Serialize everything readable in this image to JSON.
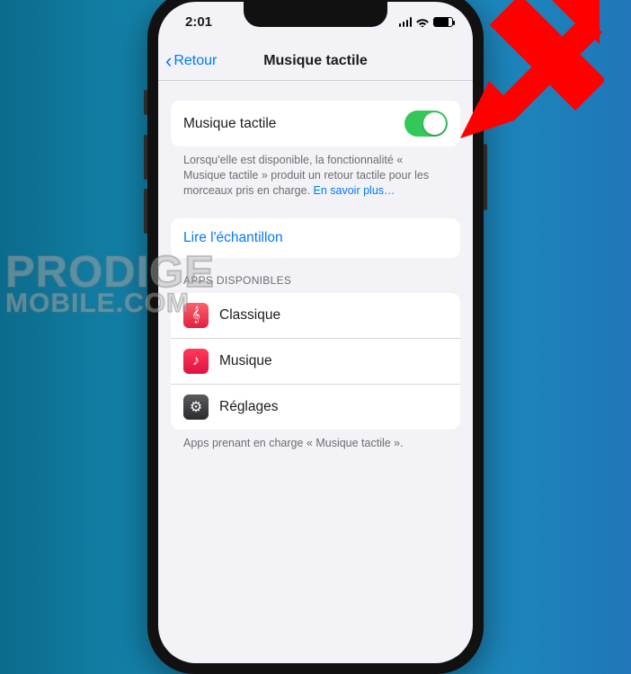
{
  "status": {
    "time": "2:01"
  },
  "nav": {
    "back": "Retour",
    "title": "Musique tactile"
  },
  "toggle": {
    "label": "Musique tactile",
    "on": true,
    "description_before": "Lorsqu'elle est disponible, la fonctionnalité « Musique tactile » produit un retour tactile pour les morceaux pris en charge. ",
    "description_link": "En savoir plus…"
  },
  "sample_link": "Lire l'échantillon",
  "apps_header": "APPS DISPONIBLES",
  "apps": {
    "a0": {
      "name": "Classique",
      "glyph": "𝄞"
    },
    "a1": {
      "name": "Musique",
      "glyph": "♪"
    },
    "a2": {
      "name": "Réglages",
      "glyph": "⚙"
    }
  },
  "apps_footer": "Apps prenant en charge « Musique tactile ».",
  "watermark": {
    "line1": "PRODIGE",
    "line2": "MOBILE.COM"
  }
}
